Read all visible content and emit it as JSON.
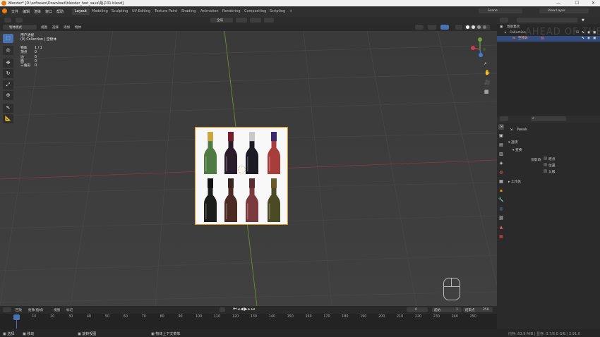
{
  "titlebar": {
    "title": "Blender* [D:\\software\\Download\\blender_fast_save\\瓶子01.blend]",
    "minimize": "—",
    "maximize": "☐",
    "close": "✕"
  },
  "menu": [
    "文件",
    "编辑",
    "渲染",
    "窗口",
    "帮助"
  ],
  "workspaces": [
    "Layout",
    "Modeling",
    "Sculpting",
    "UV Editing",
    "Texture Paint",
    "Shading",
    "Animation",
    "Rendering",
    "Compositing",
    "Scripting"
  ],
  "add_tab": "+",
  "scene": {
    "label": "Scene",
    "view_layer": "View Layer"
  },
  "viewport_header": {
    "mode": "物体模式",
    "menus": [
      "视图",
      "选择",
      "添加",
      "物体"
    ],
    "transform": "全局"
  },
  "info_overlay": {
    "view_name": "用户透视",
    "collection": "(0) Collection | 空物体",
    "stats": [
      {
        "label": "物体",
        "value": "1 / 1"
      },
      {
        "label": "顶点",
        "value": "0"
      },
      {
        "label": "边",
        "value": "0"
      },
      {
        "label": "面",
        "value": "0"
      },
      {
        "label": "三角形",
        "value": "0"
      }
    ]
  },
  "tools": [
    {
      "name": "select-box-tool",
      "glyph": "⬚"
    },
    {
      "name": "cursor-tool",
      "glyph": "◎"
    },
    {
      "name": "move-tool",
      "glyph": "✥"
    },
    {
      "name": "rotate-tool",
      "glyph": "↻"
    },
    {
      "name": "scale-tool",
      "glyph": "⤢"
    },
    {
      "name": "transform-tool",
      "glyph": "⊕"
    },
    {
      "name": "annotate-tool",
      "glyph": "✎"
    },
    {
      "name": "measure-tool",
      "glyph": "📐"
    }
  ],
  "outliner": {
    "title": "场景集合",
    "rows": [
      {
        "label": "Collection",
        "icon": "collection-icon"
      },
      {
        "label": "空物体",
        "icon": "empty-icon"
      }
    ],
    "watermark": "AHEAD OF THE CURVE"
  },
  "properties": {
    "tool_name": "Tweak",
    "sections": [
      "选项",
      "变换"
    ],
    "affect_label": "仅影响",
    "checkboxes": [
      "原点",
      "位置",
      "父级"
    ],
    "workspace_section": "工作区"
  },
  "timeline": {
    "menus": [
      "回放",
      "抠像(插帧)",
      "视图",
      "标记"
    ],
    "current_frame": "0",
    "start_label": "起始",
    "start": "1",
    "end_label": "结束点",
    "end": "250",
    "ticks": [
      "0",
      "10",
      "20",
      "30",
      "40",
      "50",
      "60",
      "70",
      "80",
      "90",
      "100",
      "110",
      "120",
      "130",
      "140",
      "150",
      "160",
      "170",
      "180",
      "190",
      "200",
      "210",
      "220",
      "230",
      "240",
      "250"
    ]
  },
  "statusbar": {
    "select": "选择",
    "move": "移动",
    "rotate_view": "旋转视图",
    "context_menu": "物体上下文菜单",
    "stats": "内存: 63.9 MiB | 显存: 0.7/6.0 GiB | 2.91.0"
  },
  "bottles": [
    {
      "color": "#4f7a44",
      "cap": "#c8a640"
    },
    {
      "color": "#2a1c2a",
      "cap": "#7a1d2a"
    },
    {
      "color": "#1b1b24",
      "cap": "#c9c9c9"
    },
    {
      "color": "#a83e3b",
      "cap": "#3a2a6a"
    },
    {
      "color": "#1c1e1c",
      "cap": "#111"
    },
    {
      "color": "#4a2a22",
      "cap": "#3a2420"
    },
    {
      "color": "#7a3a3e",
      "cap": "#5a2a30"
    },
    {
      "color": "#4a4a24",
      "cap": "#6a5a2a"
    }
  ]
}
